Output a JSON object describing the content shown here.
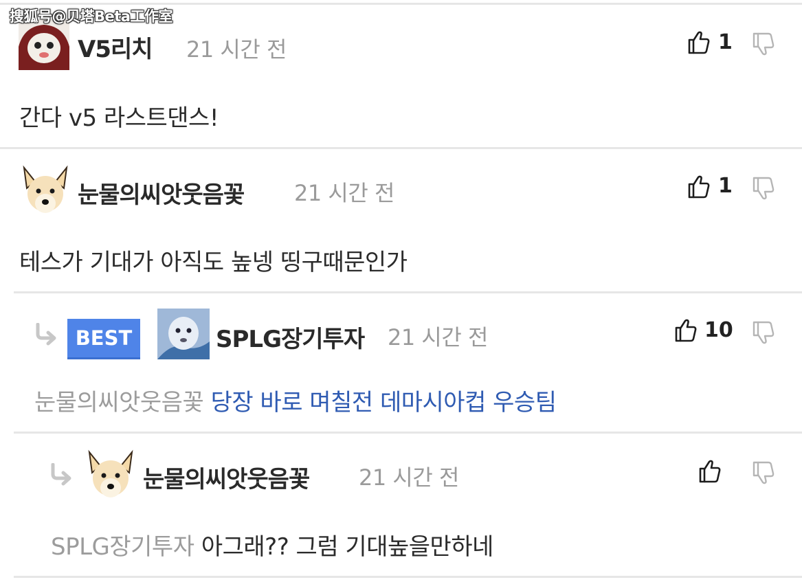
{
  "watermark": "搜狐号@贝塔Beta工作室",
  "comments": [
    {
      "author": "V5리치",
      "time": "21 시간 전",
      "likes": "1",
      "text": "간다 v5 라스트댄스!"
    },
    {
      "author": "눈물의씨앗웃음꽃",
      "time": "21 시간 전",
      "likes": "1",
      "text": "테스가 기대가 아직도 높넹 띵구때문인가"
    },
    {
      "badge": "BEST",
      "author": "SPLG장기투자",
      "time": "21 시간 전",
      "likes": "10",
      "mention": "눈물의씨앗웃음꽃",
      "text": "당장 바로 며칠전 데마시아컵 우승팀"
    },
    {
      "author": "눈물의씨앗웃음꽃",
      "time": "21 시간 전",
      "likes": "",
      "mention": "SPLG장기투자",
      "text": "아그래?? 그럼 기대높을만하네"
    }
  ],
  "colors": {
    "best_badge": "#4f84e8",
    "reply_text": "#2f5bb2",
    "separator": "#e6e6e6"
  }
}
